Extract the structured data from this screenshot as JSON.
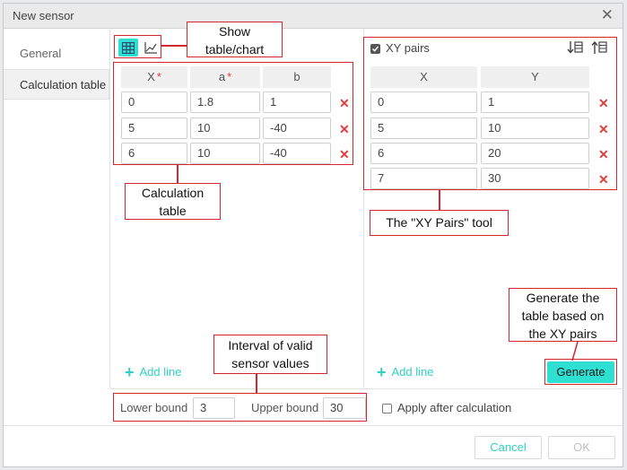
{
  "dialog": {
    "title": "New sensor"
  },
  "sidebar": {
    "items": [
      {
        "label": "General"
      },
      {
        "label": "Calculation table"
      }
    ]
  },
  "toolbar": {
    "table_icon": "table-icon",
    "chart_icon": "chart-icon"
  },
  "left_table": {
    "headers": [
      {
        "label": "X",
        "required": "*"
      },
      {
        "label": "a",
        "required": "*"
      },
      {
        "label": "b"
      }
    ],
    "rows": [
      [
        "0",
        "1.8",
        "1"
      ],
      [
        "5",
        "10",
        "-40"
      ],
      [
        "6",
        "10",
        "-40"
      ]
    ],
    "add_line": "Add line"
  },
  "xy_pairs": {
    "label": "XY pairs",
    "checked": true,
    "headers": [
      "X",
      "Y"
    ],
    "rows": [
      [
        "0",
        "1"
      ],
      [
        "5",
        "10"
      ],
      [
        "6",
        "20"
      ],
      [
        "7",
        "30"
      ]
    ],
    "add_line": "Add line",
    "generate": "Generate"
  },
  "bounds": {
    "lower_label": "Lower bound",
    "lower_value": "3",
    "upper_label": "Upper bound",
    "upper_value": "30"
  },
  "apply_after": {
    "label": "Apply after calculation",
    "checked": false
  },
  "footer": {
    "cancel": "Cancel",
    "ok": "OK"
  },
  "callouts": {
    "show_table_chart": [
      "Show",
      "table/chart"
    ],
    "calc_table": [
      "Calculation",
      "table"
    ],
    "xy_tool": "The \"XY Pairs\" tool",
    "interval": [
      "Interval of valid",
      "sensor values"
    ],
    "generate_table": [
      "Generate the",
      "table based on",
      "the XY pairs"
    ]
  },
  "colors": {
    "accent": "#2ee0d2",
    "annotation_red": "#d4262e",
    "delete_red": "#e23c3c"
  }
}
